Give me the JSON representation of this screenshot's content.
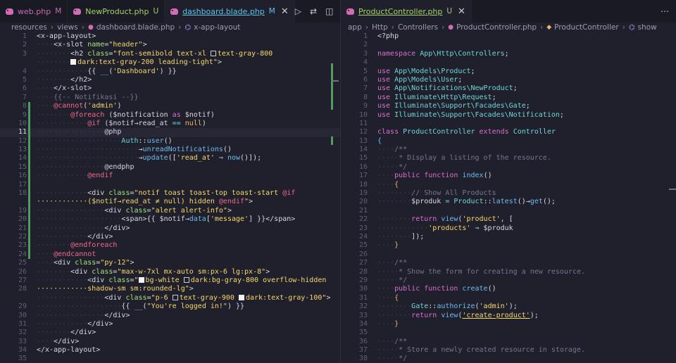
{
  "left": {
    "tabs": [
      {
        "label": "web.php",
        "status": "M",
        "active": false
      },
      {
        "label": "NewProduct.php",
        "status": "U",
        "active": false
      },
      {
        "label": "dashboard.blade.php",
        "status": "M",
        "active": true
      }
    ],
    "breadcrumb": [
      "resources",
      "views",
      "dashboard.blade.php",
      "x-app-layout"
    ],
    "current_line": 11,
    "lines": [
      [
        [
          "t",
          "<x-app-layout>"
        ]
      ],
      [
        [
          "w",
          "····"
        ],
        [
          "t",
          "<x-slot "
        ],
        [
          "g",
          "name"
        ],
        [
          "t",
          "="
        ],
        [
          "y",
          "\"header\""
        ],
        [
          "t",
          ">"
        ]
      ],
      [
        [
          "w",
          "········"
        ],
        [
          "t",
          "<h2 "
        ],
        [
          "g",
          "class"
        ],
        [
          "t",
          "="
        ],
        [
          "y",
          "\"font-semibold text-xl "
        ],
        [
          "sq",
          ""
        ],
        [
          "y",
          "text-gray-800"
        ]
      ],
      [
        [
          "w",
          "········"
        ],
        [
          "sq",
          "f"
        ],
        [
          "y",
          "dark:text-gray-200 leading-tight\""
        ],
        [
          "t",
          ">"
        ]
      ],
      [
        [
          "w",
          "············"
        ],
        [
          "t",
          "{{ "
        ],
        [
          "b",
          "__"
        ],
        [
          "t",
          "("
        ],
        [
          "y",
          "'Dashboard'"
        ],
        [
          "t",
          ") }}"
        ]
      ],
      [
        [
          "w",
          "········"
        ],
        [
          "t",
          "</h2>"
        ]
      ],
      [
        [
          "w",
          "····"
        ],
        [
          "t",
          "</x-slot>"
        ]
      ],
      [
        [
          "w",
          "····"
        ],
        [
          "m",
          "{{-- Notifikasi --}}"
        ]
      ],
      [
        [
          "w",
          "····"
        ],
        [
          "r",
          "@cannot"
        ],
        [
          "t",
          "("
        ],
        [
          "y",
          "'admin'"
        ],
        [
          "t",
          ")"
        ]
      ],
      [
        [
          "w",
          "········"
        ],
        [
          "r",
          "@foreach"
        ],
        [
          "t",
          " ($notification "
        ],
        [
          "p",
          "as"
        ],
        [
          "t",
          " $notif)"
        ]
      ],
      [
        [
          "w",
          "············"
        ],
        [
          "r",
          "@if"
        ],
        [
          "t",
          " ($notif→read_at "
        ],
        [
          "c",
          "=="
        ],
        [
          "t",
          " "
        ],
        [
          "o",
          "null"
        ],
        [
          "t",
          ")"
        ]
      ],
      [
        [
          "w",
          "················"
        ],
        [
          "t",
          "@php"
        ]
      ],
      [
        [
          "w",
          "····················"
        ],
        [
          "c",
          "Auth"
        ],
        [
          "t",
          "::"
        ],
        [
          "b",
          "user"
        ],
        [
          "t",
          "()"
        ]
      ],
      [
        [
          "w",
          "························"
        ],
        [
          "t",
          "→"
        ],
        [
          "b",
          "unreadNotifications"
        ],
        [
          "t",
          "()"
        ]
      ],
      [
        [
          "w",
          "························"
        ],
        [
          "t",
          "→"
        ],
        [
          "b",
          "update"
        ],
        [
          "t",
          "(["
        ],
        [
          "y",
          "'read_at'"
        ],
        [
          "t",
          " ⇒ "
        ],
        [
          "b",
          "now"
        ],
        [
          "t",
          "()]);"
        ]
      ],
      [
        [
          "w",
          "················"
        ],
        [
          "t",
          "@endphp"
        ]
      ],
      [
        [
          "w",
          "············"
        ],
        [
          "r",
          "@endif"
        ]
      ],
      [],
      [
        [
          "w",
          "············"
        ],
        [
          "t",
          "<div "
        ],
        [
          "g",
          "class"
        ],
        [
          "t",
          "="
        ],
        [
          "y",
          "\"notif toast toast-top toast-start "
        ],
        [
          "r",
          "@if"
        ]
      ],
      [
        [
          "y",
          "············($notif→read_at ≠ null) hidden "
        ],
        [
          "r",
          "@endif"
        ],
        [
          "y",
          "\""
        ],
        [
          "t",
          ">"
        ]
      ],
      [
        [
          "w",
          "················"
        ],
        [
          "t",
          "<div "
        ],
        [
          "g",
          "class"
        ],
        [
          "t",
          "="
        ],
        [
          "y",
          "\"alert alert-info\""
        ],
        [
          "t",
          ">"
        ]
      ],
      [
        [
          "w",
          "····················"
        ],
        [
          "t",
          "<span>{{ $notif→"
        ],
        [
          "b",
          "data"
        ],
        [
          "t",
          "["
        ],
        [
          "y",
          "'message'"
        ],
        [
          "t",
          "] }}</span>"
        ]
      ],
      [
        [
          "w",
          "················"
        ],
        [
          "t",
          "</div>"
        ]
      ],
      [
        [
          "w",
          "············"
        ],
        [
          "t",
          "</div>"
        ]
      ],
      [
        [
          "w",
          "········"
        ],
        [
          "r",
          "@endforeach"
        ]
      ],
      [
        [
          "w",
          "····"
        ],
        [
          "r",
          "@endcannot"
        ]
      ],
      [
        [
          "w",
          "····"
        ],
        [
          "t",
          "<div "
        ],
        [
          "g",
          "class"
        ],
        [
          "t",
          "="
        ],
        [
          "y",
          "\"py-12\""
        ],
        [
          "t",
          ">"
        ]
      ],
      [
        [
          "w",
          "········"
        ],
        [
          "t",
          "<div "
        ],
        [
          "g",
          "class"
        ],
        [
          "t",
          "="
        ],
        [
          "y",
          "\"max-w-7xl mx-auto sm:px-6 lg:px-8\""
        ],
        [
          "t",
          ">"
        ]
      ],
      [
        [
          "w",
          "············"
        ],
        [
          "t",
          "<div "
        ],
        [
          "g",
          "class"
        ],
        [
          "t",
          "="
        ],
        [
          "y",
          "\""
        ],
        [
          "sq",
          "f"
        ],
        [
          "y",
          "bg-white "
        ],
        [
          "sq",
          ""
        ],
        [
          "y",
          "dark:bg-gray-800 overflow-hidden"
        ]
      ],
      [
        [
          "y",
          "············shadow-sm sm:rounded-lg\""
        ],
        [
          "t",
          ">"
        ]
      ],
      [
        [
          "w",
          "················"
        ],
        [
          "t",
          "<div "
        ],
        [
          "g",
          "class"
        ],
        [
          "t",
          "="
        ],
        [
          "y",
          "\"p-6 "
        ],
        [
          "sq",
          ""
        ],
        [
          "y",
          "text-gray-900 "
        ],
        [
          "sq",
          "f"
        ],
        [
          "y",
          "dark:text-gray-100\""
        ],
        [
          "t",
          ">"
        ]
      ],
      [
        [
          "w",
          "····················"
        ],
        [
          "t",
          "{{ "
        ],
        [
          "b",
          "__"
        ],
        [
          "t",
          "("
        ],
        [
          "y",
          "\"You're logged in!\""
        ],
        [
          "t",
          ") }}"
        ]
      ],
      [
        [
          "w",
          "················"
        ],
        [
          "t",
          "</div>"
        ]
      ],
      [
        [
          "w",
          "············"
        ],
        [
          "t",
          "</div>"
        ]
      ],
      [
        [
          "w",
          "········"
        ],
        [
          "t",
          "</div>"
        ]
      ],
      [
        [
          "w",
          "····"
        ],
        [
          "t",
          "</div>"
        ]
      ],
      [
        [
          "t",
          "</x-app-layout>"
        ]
      ],
      []
    ],
    "line_numbers": [
      "1",
      "2",
      "3",
      "",
      "4",
      "5",
      "6",
      "7",
      "8",
      "9",
      "10",
      "11",
      "12",
      "13",
      "14",
      "15",
      "16",
      "17",
      "18",
      "",
      "19",
      "20",
      "21",
      "22",
      "23",
      "24",
      "25",
      "26",
      "27",
      "28",
      "",
      "29",
      "30",
      "31",
      "32",
      "33",
      "34",
      "35"
    ]
  },
  "right": {
    "tabs": [
      {
        "label": "ProductController.php",
        "status": "U",
        "active": true
      }
    ],
    "breadcrumb": [
      "app",
      "Http",
      "Controllers",
      "ProductController.php",
      "ProductController",
      "show"
    ],
    "lines": [
      [
        [
          "t",
          "<?php"
        ]
      ],
      [],
      [
        [
          "p",
          "namespace"
        ],
        [
          "t",
          " "
        ],
        [
          "c",
          "App\\Http\\Controllers"
        ],
        [
          "t",
          ";"
        ]
      ],
      [],
      [
        [
          "p",
          "use"
        ],
        [
          "t",
          " "
        ],
        [
          "c",
          "App\\Models\\Product"
        ],
        [
          "t",
          ";"
        ]
      ],
      [
        [
          "p",
          "use"
        ],
        [
          "t",
          " "
        ],
        [
          "c",
          "App\\Models\\User"
        ],
        [
          "t",
          ";"
        ]
      ],
      [
        [
          "p",
          "use"
        ],
        [
          "t",
          " "
        ],
        [
          "c",
          "App\\Notifications\\NewProduct"
        ],
        [
          "t",
          ";"
        ]
      ],
      [
        [
          "p",
          "use"
        ],
        [
          "t",
          " "
        ],
        [
          "c",
          "Illuminate\\Http\\Request"
        ],
        [
          "t",
          ";"
        ]
      ],
      [
        [
          "p",
          "use"
        ],
        [
          "t",
          " "
        ],
        [
          "c",
          "Illuminate\\Support\\Facades\\Gate"
        ],
        [
          "t",
          ";"
        ]
      ],
      [
        [
          "p",
          "use"
        ],
        [
          "t",
          " "
        ],
        [
          "c",
          "Illuminate\\Support\\Facades\\Notification"
        ],
        [
          "t",
          ";"
        ]
      ],
      [],
      [
        [
          "p",
          "class"
        ],
        [
          "t",
          " "
        ],
        [
          "c",
          "ProductController"
        ],
        [
          "t",
          " "
        ],
        [
          "p",
          "extends"
        ],
        [
          "t",
          " "
        ],
        [
          "c",
          "Controller"
        ]
      ],
      [
        [
          "b",
          "{"
        ]
      ],
      [
        [
          "w",
          "····"
        ],
        [
          "m",
          "/**"
        ]
      ],
      [
        [
          "w",
          "·····"
        ],
        [
          "m",
          "* Display a listing of the resource."
        ]
      ],
      [
        [
          "w",
          "·····"
        ],
        [
          "m",
          "*/"
        ]
      ],
      [
        [
          "w",
          "····"
        ],
        [
          "p",
          "public"
        ],
        [
          "t",
          " "
        ],
        [
          "p",
          "function"
        ],
        [
          "t",
          " "
        ],
        [
          "b",
          "index"
        ],
        [
          "t",
          "()"
        ]
      ],
      [
        [
          "w",
          "····"
        ],
        [
          "o",
          "{"
        ]
      ],
      [
        [
          "w",
          "········"
        ],
        [
          "m",
          "// Show All Products"
        ]
      ],
      [
        [
          "w",
          "········"
        ],
        [
          "t",
          "$produk "
        ],
        [
          "c",
          "="
        ],
        [
          "t",
          " "
        ],
        [
          "c",
          "Product"
        ],
        [
          "t",
          "::"
        ],
        [
          "b",
          "latest"
        ],
        [
          "t",
          "()→"
        ],
        [
          "b",
          "get"
        ],
        [
          "t",
          "();"
        ]
      ],
      [],
      [
        [
          "w",
          "········"
        ],
        [
          "p",
          "return"
        ],
        [
          "t",
          " "
        ],
        [
          "b",
          "view"
        ],
        [
          "t",
          "("
        ],
        [
          "y",
          "'product'"
        ],
        [
          "t",
          ", ["
        ]
      ],
      [
        [
          "w",
          "············"
        ],
        [
          "y",
          "'products'"
        ],
        [
          "t",
          " ⇒ $produk"
        ]
      ],
      [
        [
          "w",
          "········"
        ],
        [
          "t",
          "]);"
        ]
      ],
      [
        [
          "w",
          "····"
        ],
        [
          "o",
          "}"
        ]
      ],
      [],
      [
        [
          "w",
          "····"
        ],
        [
          "m",
          "/**"
        ]
      ],
      [
        [
          "w",
          "·····"
        ],
        [
          "m",
          "* Show the form for creating a new resource."
        ]
      ],
      [
        [
          "w",
          "·····"
        ],
        [
          "m",
          "*/"
        ]
      ],
      [
        [
          "w",
          "····"
        ],
        [
          "p",
          "public"
        ],
        [
          "t",
          " "
        ],
        [
          "p",
          "function"
        ],
        [
          "t",
          " "
        ],
        [
          "b",
          "create"
        ],
        [
          "t",
          "()"
        ]
      ],
      [
        [
          "w",
          "····"
        ],
        [
          "o",
          "{"
        ]
      ],
      [
        [
          "w",
          "········"
        ],
        [
          "c",
          "Gate"
        ],
        [
          "t",
          "::"
        ],
        [
          "b",
          "authorize"
        ],
        [
          "t",
          "("
        ],
        [
          "y",
          "'admin'"
        ],
        [
          "t",
          ");"
        ]
      ],
      [
        [
          "w",
          "········"
        ],
        [
          "p",
          "return"
        ],
        [
          "t",
          " "
        ],
        [
          "b",
          "view"
        ],
        [
          "t",
          "("
        ],
        [
          "yu",
          "'create-product'"
        ],
        [
          "t",
          ");"
        ]
      ],
      [
        [
          "w",
          "····"
        ],
        [
          "o",
          "}"
        ]
      ],
      [],
      [
        [
          "w",
          "····"
        ],
        [
          "m",
          "/**"
        ]
      ],
      [
        [
          "w",
          "·····"
        ],
        [
          "m",
          "* Store a newly created resource in storage."
        ]
      ],
      [
        [
          "w",
          "·····"
        ],
        [
          "m",
          "*/"
        ]
      ]
    ],
    "line_numbers": [
      "1",
      "2",
      "3",
      "4",
      "5",
      "6",
      "7",
      "8",
      "9",
      "10",
      "11",
      "12",
      "13",
      "14",
      "15",
      "16",
      "17",
      "18",
      "19",
      "20",
      "21",
      "22",
      "23",
      "24",
      "25",
      "26",
      "27",
      "28",
      "29",
      "30",
      "31",
      "32",
      "33",
      "34",
      "35",
      "36",
      "37",
      "38"
    ]
  },
  "icons": {
    "run": "play-icon",
    "compare": "compare-icon",
    "split": "split-editor-icon",
    "more": "more-actions-icon"
  }
}
